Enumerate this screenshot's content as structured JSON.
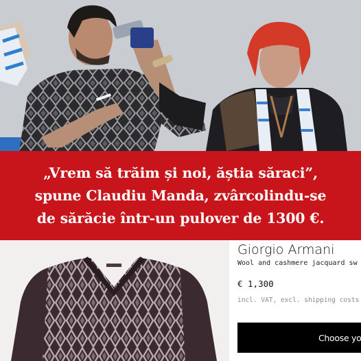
{
  "caption": {
    "line1": "„Vrem să trăim și noi, ăștia săraci”,",
    "line2": "spune Claudiu Manda, zvârcolindu-se",
    "line3": "de sărăcie într-un pulover de 1300 €."
  },
  "product": {
    "brand": "Giorgio Armani",
    "description": "Wool and cashmere jacquard sw",
    "price": "€ 1,300",
    "tax_note": "incl. VAT, excl. shipping costs",
    "choose_button": "Choose you"
  },
  "colors": {
    "banner": "#c8151b",
    "sweater": "#3b2a30",
    "sweater_pattern": "#c9bfc4"
  }
}
